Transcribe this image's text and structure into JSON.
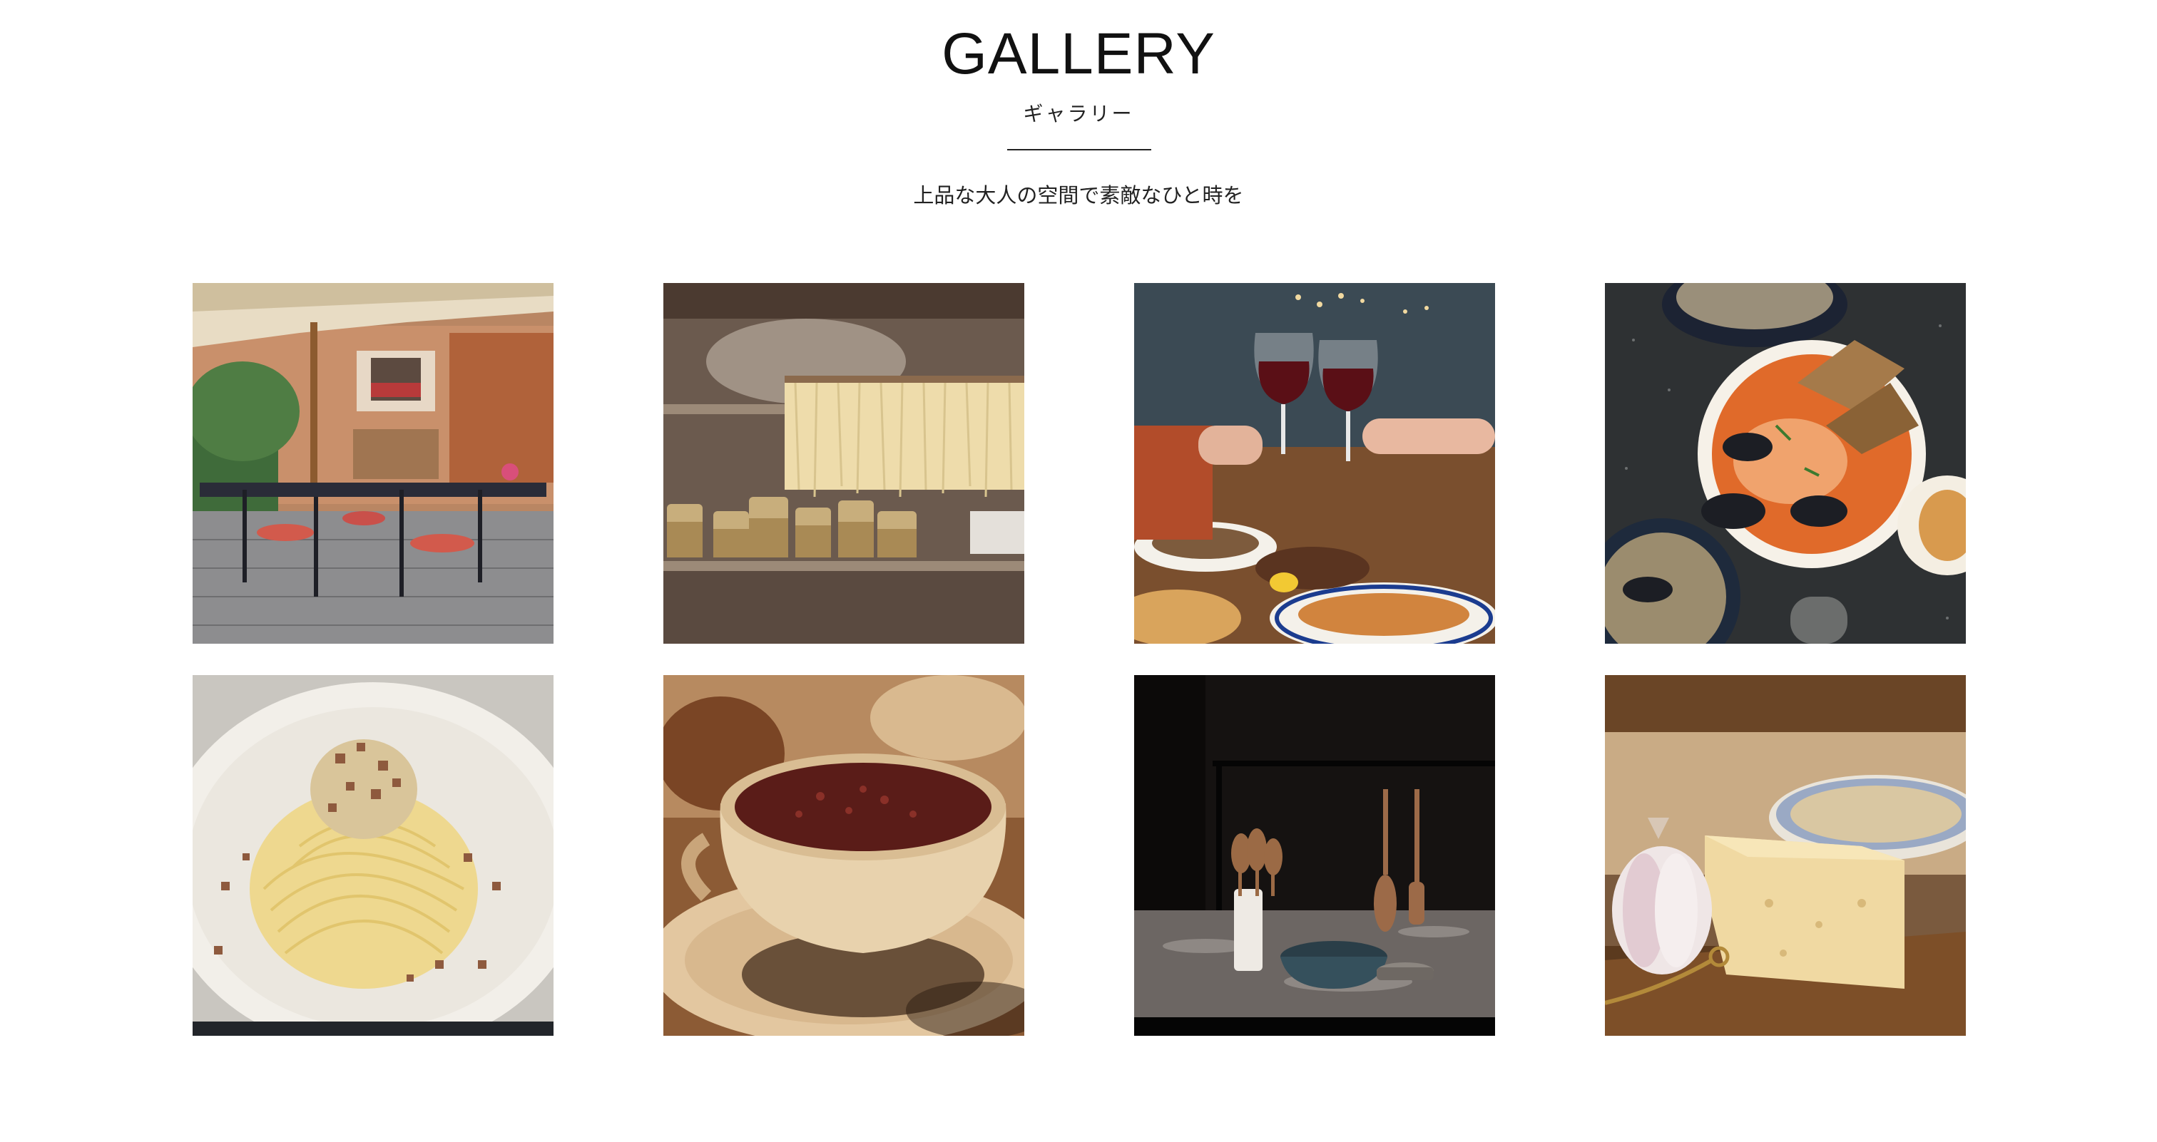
{
  "header": {
    "title": "GALLERY",
    "subtitle": "ギャラリー",
    "tagline": "上品な大人の空間で素敵なひと時を"
  },
  "gallery": {
    "items": [
      {
        "subject": "terrace-cafe"
      },
      {
        "subject": "fresh-pasta-drying"
      },
      {
        "subject": "wine-toast"
      },
      {
        "subject": "seafood-stew"
      },
      {
        "subject": "carbonara"
      },
      {
        "subject": "cappuccino"
      },
      {
        "subject": "kitchen-utensils"
      },
      {
        "subject": "garlic-and-parmesan"
      }
    ]
  },
  "colors": {
    "background": "#ffffff",
    "text": "#111111",
    "rule": "#222222"
  }
}
